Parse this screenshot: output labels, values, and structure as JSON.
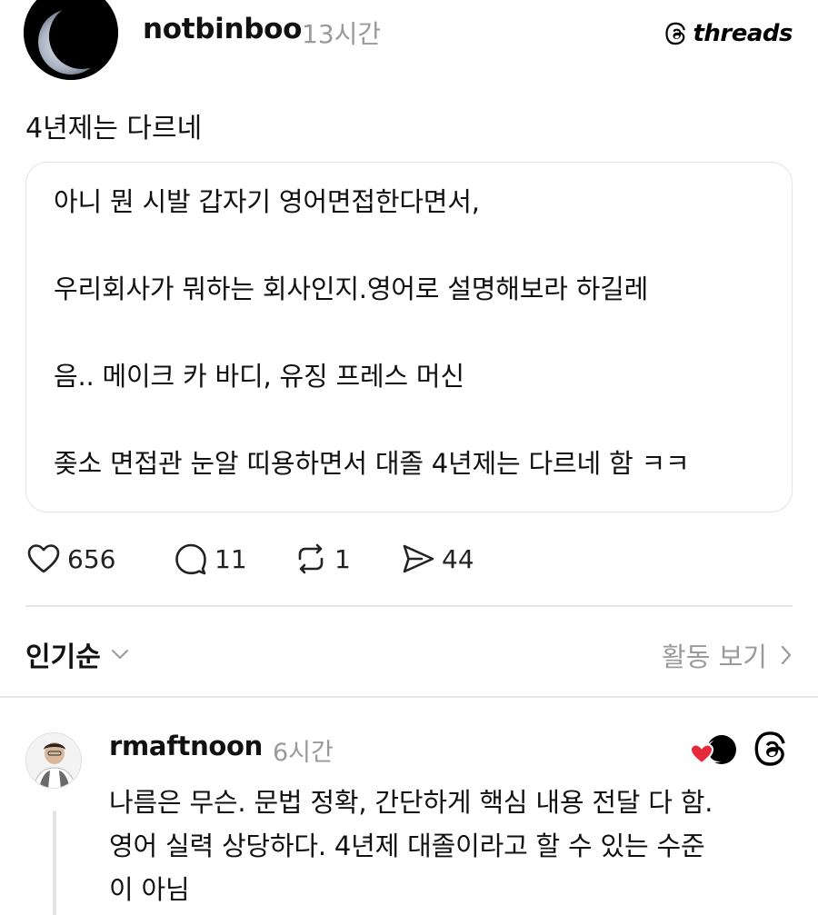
{
  "post": {
    "username": "notbinboo",
    "timestamp": "13시간",
    "brand": "threads",
    "caption": "4년제는 다르네",
    "quote_lines": [
      "아니 뭔 시발 갑자기 영어면접한다면서,",
      "우리회사가 뭐하는 회사인지.영어로 설명해보라 하길레",
      "음.. 메이크 카 바디, 유징 프레스 머신",
      "좆소 면접관 눈알 띠용하면서 대졸 4년제는 다르네 함 ㅋㅋ"
    ],
    "actions": {
      "likes": "656",
      "replies": "11",
      "reposts": "1",
      "shares": "44"
    }
  },
  "sort": {
    "label": "인기순",
    "activity_label": "활동 보기"
  },
  "reply": {
    "username": "rmaftnoon",
    "timestamp": "6시간",
    "lines": [
      "나름은 무슨. 문법 정확, 간단하게 핵심 내용 전달 다 함.",
      "영어 실력 상당하다. 4년제 대졸이라고 할 수 있는 수준",
      "이 아님"
    ]
  },
  "icons": {
    "like": "heart-icon",
    "reply": "comment-icon",
    "repost": "repost-icon",
    "share": "share-icon",
    "brand": "threads-logo-icon",
    "liked_by": "liked-by-author-icon",
    "sort_chevron": "chevron-down-icon",
    "activity_chevron": "chevron-right-icon"
  },
  "colors": {
    "text": "#111111",
    "muted": "#9a9a9a",
    "divider": "#e6e6e6",
    "heart": "#e8293b"
  }
}
